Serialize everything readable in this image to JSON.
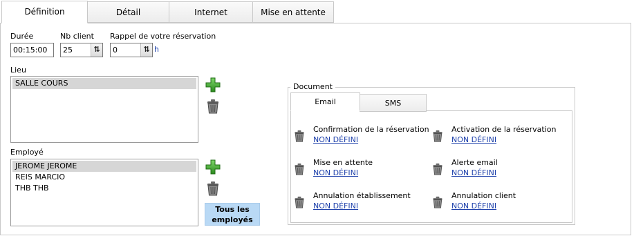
{
  "tabs": [
    {
      "label": "Définition"
    },
    {
      "label": "Détail"
    },
    {
      "label": "Internet"
    },
    {
      "label": "Mise en attente"
    }
  ],
  "duration": {
    "label": "Durée",
    "value": "00:15:00"
  },
  "nb_client": {
    "label": "Nb client",
    "value": "25",
    "spin_icon": "updown-arrows-icon"
  },
  "reminder": {
    "label": "Rappel de votre réservation",
    "value": "0",
    "unit": "h",
    "spin_icon": "updown-arrows-icon"
  },
  "lieu": {
    "label": "Lieu",
    "items": [
      {
        "label": "SALLE COURS",
        "selected": true
      }
    ],
    "add_icon": "add-icon",
    "delete_icon": "trash-icon"
  },
  "employe": {
    "label": "Employé",
    "items": [
      {
        "label": "JEROME JEROME",
        "selected": true
      },
      {
        "label": "REIS MARCIO",
        "selected": false
      },
      {
        "label": "THB THB",
        "selected": false
      }
    ],
    "add_icon": "add-icon",
    "delete_icon": "trash-icon",
    "all_button": "Tous les employés"
  },
  "document": {
    "label": "Document",
    "tabs": [
      {
        "label": "Email"
      },
      {
        "label": "SMS"
      }
    ],
    "items": [
      {
        "title": "Confirmation de la réservation",
        "link": "NON DÉFINI"
      },
      {
        "title": "Activation de la réservation",
        "link": "NON DÉFINI"
      },
      {
        "title": "Mise en attente",
        "link": "NON DÉFINI"
      },
      {
        "title": "Alerte email",
        "link": "NON DÉFINI"
      },
      {
        "title": "Annulation établissement",
        "link": "NON DÉFINI"
      },
      {
        "title": "Annulation client",
        "link": "NON DÉFINI"
      }
    ]
  },
  "colors": {
    "link": "#1c3faa",
    "selection": "#d6d6d6",
    "all_button": "#b9d9f5",
    "add_green": "#3aa52b"
  }
}
